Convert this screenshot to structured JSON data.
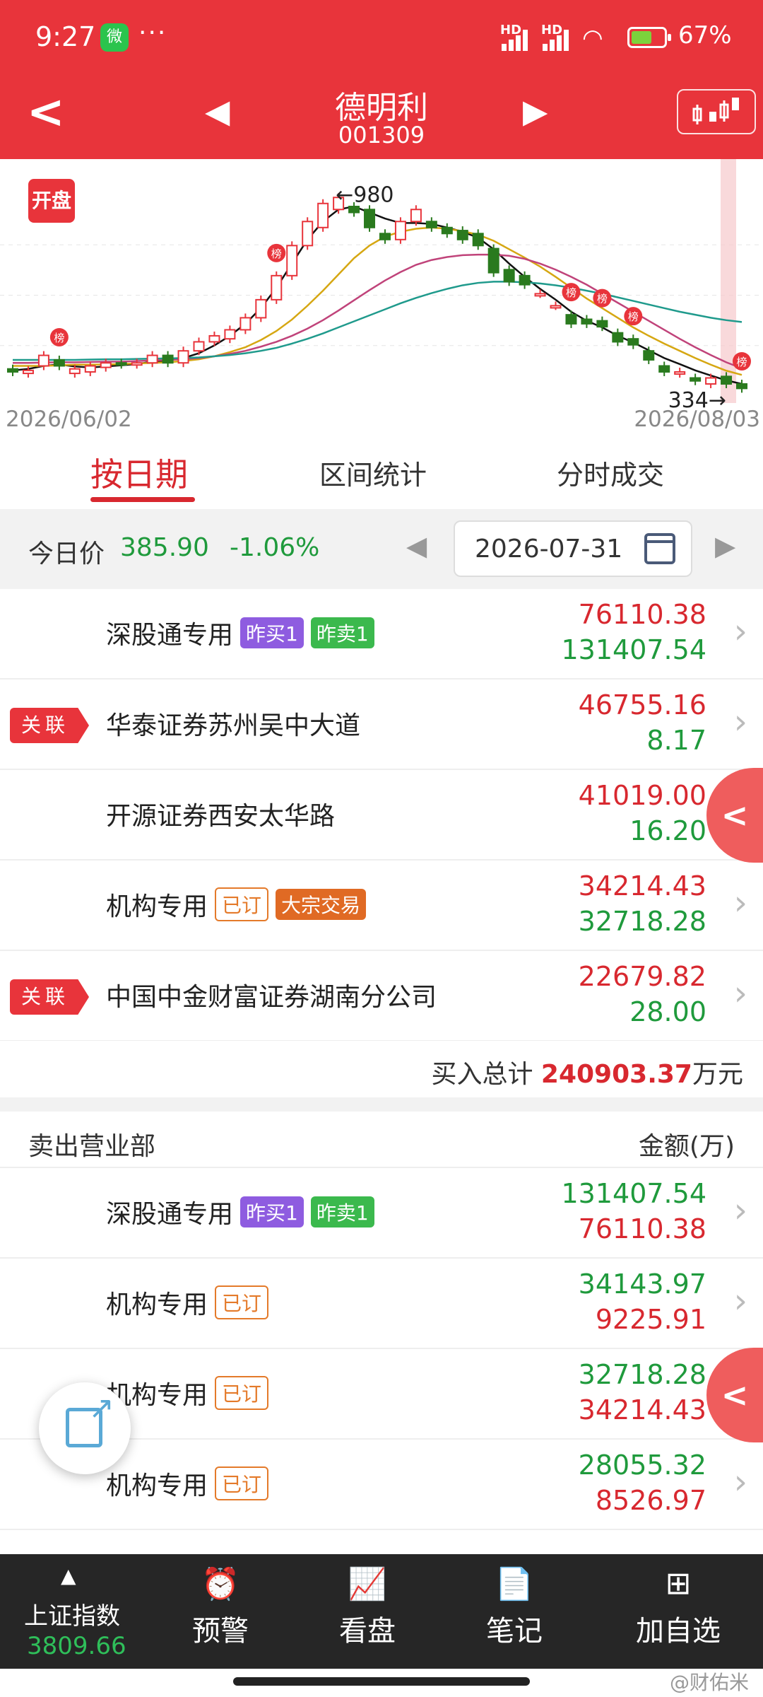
{
  "status": {
    "time": "9:27",
    "wechat": "微",
    "dots": "···",
    "hd1": "HD",
    "hd2": "HD",
    "battery": "67%",
    "battery_color": "#7cd23c"
  },
  "nav": {
    "back": "<",
    "prev": "◀",
    "next": "▶",
    "title": "德明利",
    "code": "001309"
  },
  "chart": {
    "kaipan": "开盘",
    "bang": "榜",
    "high_label": "←980",
    "low_label": "334→",
    "start_date": "2026/06/02",
    "end_date": "2026/08/03"
  },
  "chart_data": {
    "type": "line",
    "x_range": [
      "2026/06/02",
      "2026/08/03"
    ],
    "annotations": [
      {
        "text": "←980",
        "value": 980
      },
      {
        "text": "334→",
        "value": 334
      }
    ],
    "candles": [
      {
        "o": 410,
        "c": 400
      },
      {
        "o": 395,
        "c": 405
      },
      {
        "o": 420,
        "c": 455
      },
      {
        "o": 440,
        "c": 420
      },
      {
        "o": 395,
        "c": 410
      },
      {
        "o": 400,
        "c": 420
      },
      {
        "o": 415,
        "c": 430
      },
      {
        "o": 430,
        "c": 425
      },
      {
        "o": 425,
        "c": 430
      },
      {
        "o": 430,
        "c": 455
      },
      {
        "o": 455,
        "c": 430
      },
      {
        "o": 430,
        "c": 470
      },
      {
        "o": 470,
        "c": 500
      },
      {
        "o": 500,
        "c": 520
      },
      {
        "o": 510,
        "c": 540
      },
      {
        "o": 540,
        "c": 580
      },
      {
        "o": 580,
        "c": 640
      },
      {
        "o": 640,
        "c": 720
      },
      {
        "o": 720,
        "c": 820
      },
      {
        "o": 820,
        "c": 900
      },
      {
        "o": 880,
        "c": 960
      },
      {
        "o": 940,
        "c": 980
      },
      {
        "o": 950,
        "c": 930
      },
      {
        "o": 940,
        "c": 880
      },
      {
        "o": 860,
        "c": 840
      },
      {
        "o": 840,
        "c": 900
      },
      {
        "o": 900,
        "c": 940
      },
      {
        "o": 900,
        "c": 880
      },
      {
        "o": 880,
        "c": 860
      },
      {
        "o": 870,
        "c": 840
      },
      {
        "o": 860,
        "c": 820
      },
      {
        "o": 810,
        "c": 730
      },
      {
        "o": 740,
        "c": 700
      },
      {
        "o": 720,
        "c": 690
      },
      {
        "o": 660,
        "c": 660
      },
      {
        "o": 620,
        "c": 620
      },
      {
        "o": 590,
        "c": 560
      },
      {
        "o": 575,
        "c": 560
      },
      {
        "o": 570,
        "c": 550
      },
      {
        "o": 530,
        "c": 500
      },
      {
        "o": 510,
        "c": 490
      },
      {
        "o": 470,
        "c": 440
      },
      {
        "o": 420,
        "c": 400
      },
      {
        "o": 395,
        "c": 400
      },
      {
        "o": 380,
        "c": 370
      },
      {
        "o": 360,
        "c": 380
      },
      {
        "o": 385,
        "c": 360
      },
      {
        "o": 360,
        "c": 345
      }
    ],
    "series": [
      {
        "color": "#111111",
        "values": [
          405,
          410,
          420,
          425,
          418,
          415,
          418,
          422,
          426,
          434,
          438,
          446,
          462,
          488,
          520,
          560,
          612,
          680,
          760,
          840,
          900,
          940,
          950,
          930,
          910,
          895,
          895,
          892,
          880,
          866,
          846,
          808,
          760,
          716,
          676,
          640,
          600,
          570,
          548,
          520,
          498,
          472,
          446,
          426,
          405,
          388,
          372,
          360
        ]
      },
      {
        "color": "#d6a712",
        "values": [
          420,
          420,
          420,
          422,
          424,
          424,
          425,
          426,
          428,
          430,
          432,
          436,
          442,
          452,
          466,
          482,
          506,
          536,
          574,
          620,
          670,
          724,
          778,
          820,
          850,
          866,
          876,
          880,
          876,
          868,
          856,
          836,
          808,
          780,
          750,
          716,
          680,
          644,
          612,
          580,
          548,
          520,
          494,
          470,
          446,
          424,
          404,
          390
        ]
      },
      {
        "color": "#c0437a",
        "values": [
          430,
          430,
          431,
          432,
          432,
          433,
          434,
          434,
          436,
          438,
          440,
          442,
          446,
          452,
          460,
          470,
          484,
          500,
          520,
          544,
          572,
          604,
          638,
          672,
          704,
          732,
          756,
          772,
          782,
          788,
          790,
          790,
          786,
          776,
          760,
          740,
          716,
          690,
          660,
          630,
          600,
          570,
          540,
          510,
          482,
          456,
          432,
          412
        ]
      },
      {
        "color": "#1f9a8c",
        "values": [
          440,
          440,
          440,
          440,
          440,
          441,
          442,
          442,
          443,
          444,
          445,
          446,
          448,
          452,
          456,
          462,
          470,
          480,
          494,
          510,
          528,
          548,
          568,
          588,
          608,
          628,
          646,
          662,
          676,
          688,
          696,
          700,
          700,
          698,
          694,
          688,
          680,
          670,
          660,
          648,
          636,
          624,
          612,
          600,
          590,
          580,
          572,
          566
        ]
      }
    ]
  },
  "tabs": {
    "t1": "按日期",
    "t2": "区间统计",
    "t3": "分时成交"
  },
  "pricebar": {
    "label": "今日价",
    "price": "385.90",
    "change": "-1.06%",
    "date": "2026-07-31",
    "arrow_left": "◀",
    "arrow_right": "▶"
  },
  "buy_rows": [
    {
      "name": "深股通专用",
      "tags": [
        "昨买1",
        "昨卖1"
      ],
      "v1": "76110.38",
      "v2": "131407.54"
    },
    {
      "badge": "关联",
      "name": "华泰证券苏州吴中大道",
      "v1": "46755.16",
      "v2": "8.17"
    },
    {
      "name": "开源证券西安太华路",
      "v1": "41019.00",
      "v2": "16.20"
    },
    {
      "name": "机构专用",
      "tags": [
        "已订",
        "大宗交易"
      ],
      "v1": "34214.43",
      "v2": "32718.28"
    },
    {
      "badge": "关联",
      "name": "中国中金财富证券湖南分公司",
      "v1": "22679.82",
      "v2": "28.00"
    }
  ],
  "buy_total": {
    "label": "买入总计",
    "amount": "240903.37",
    "unit": "万元"
  },
  "sell_header": {
    "left": "卖出营业部",
    "right": "金额(万)"
  },
  "sell_rows": [
    {
      "name": "深股通专用",
      "tags": [
        "昨买1",
        "昨卖1"
      ],
      "v1": "131407.54",
      "v2": "76110.38"
    },
    {
      "name": "机构专用",
      "tags": [
        "已订"
      ],
      "v1": "34143.97",
      "v2": "9225.91"
    },
    {
      "name": "机构专用",
      "tags": [
        "已订"
      ],
      "v1": "32718.28",
      "v2": "34214.43"
    },
    {
      "name": "机构专用",
      "tags": [
        "已订"
      ],
      "v1": "28055.32",
      "v2": "8526.97"
    }
  ],
  "sidetab": "<",
  "chevron": "›",
  "bottom": {
    "index_arrow": "▲",
    "index_name": "上证指数",
    "index_value": "3809.66",
    "items": [
      {
        "icon": "⏰",
        "label": "预警"
      },
      {
        "icon": "📈",
        "label": "看盘"
      },
      {
        "icon": "📄",
        "label": "笔记"
      },
      {
        "icon": "⊞",
        "label": "加自选"
      }
    ]
  },
  "watermark": "@财佑米"
}
